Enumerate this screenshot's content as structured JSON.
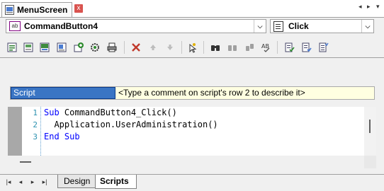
{
  "window": {
    "tab_title": "MenuScreen",
    "close_glyph": "x"
  },
  "nav": {
    "left_arrow": "◂",
    "right_arrow": "▸",
    "menu_arrow": "▾"
  },
  "object_combo": {
    "icon_text": "ab",
    "value": "CommandButton4",
    "dropdown_glyph": "⌵"
  },
  "event_combo": {
    "value": "Click",
    "dropdown_glyph": "⌵"
  },
  "toolbar": {
    "icons": [
      "new-script-icon",
      "add-screen-script-icon",
      "picture-script-icon",
      "form-script-icon",
      "import-icon",
      "gear-refresh-icon",
      "print-icon",
      "delete-icon",
      "move-up-icon",
      "move-down-icon",
      "cursor-sparkle-icon",
      "find-icon",
      "find-next-icon",
      "replace-icon",
      "spell-check-icon",
      "document-check-icon",
      "document-list-icon",
      "document-checklist-icon"
    ]
  },
  "script": {
    "name": "Script",
    "comment_hint": "<Type a comment on script's row 2 to describe it>",
    "line_numbers": [
      "1",
      "2",
      "3"
    ],
    "lines": [
      {
        "kw1": "Sub",
        "text": " CommandButton4_Click()"
      },
      {
        "indent_text": "  Application.UserAdministration()"
      },
      {
        "kw1": "End",
        "kw2": " Sub"
      }
    ]
  },
  "bottom_tabs": {
    "design": "Design",
    "scripts": "Scripts"
  },
  "bottom_nav": {
    "first": "|◂",
    "prev": "◂",
    "next": "▸",
    "last": "▸|"
  },
  "colors": {
    "selection": "#3a75c4",
    "keyword": "#0000ff",
    "comment_bg": "#ffffe1",
    "delete": "#c0392b"
  }
}
